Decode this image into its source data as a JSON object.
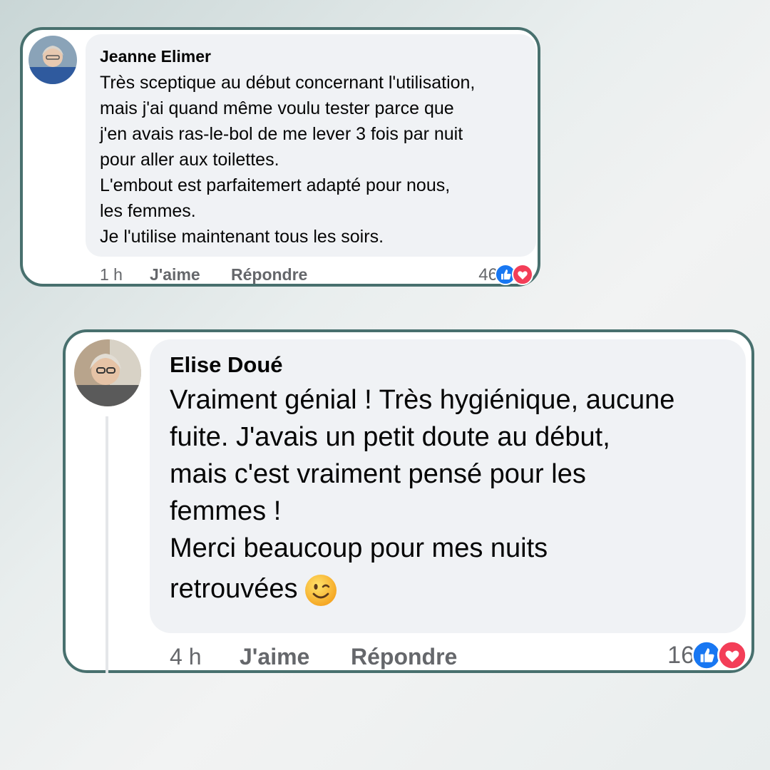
{
  "comments": [
    {
      "author": "Jeanne Elimer",
      "lines": [
        "Très sceptique au début concernant l'utilisation,",
        "mais j'ai quand même voulu tester parce que",
        "j'en avais ras-le-bol de me lever 3 fois par nuit",
        "pour aller aux toilettes.",
        "L'embout est parfaitemert adapté pour nous,",
        "les femmes.",
        "Je l'utilise maintenant tous les soirs."
      ],
      "time": "1 h",
      "like_label": "J'aime",
      "reply_label": "Répondre",
      "reaction_count": "46",
      "reaction_icons": [
        "like-icon",
        "love-icon"
      ]
    },
    {
      "author": "Elise Doué",
      "lines": [
        "Vraiment génial ! Très hygiénique, aucune",
        "fuite. J'avais un petit doute au début,",
        "mais c'est vraiment pensé pour les",
        "femmes !",
        "Merci beaucoup pour mes nuits",
        "retrouvées"
      ],
      "trailing_emoji": "winking-face-emoji",
      "time": "4 h",
      "like_label": "J'aime",
      "reply_label": "Répondre",
      "reaction_count": "16",
      "reaction_icons": [
        "like-icon",
        "love-icon"
      ]
    }
  ],
  "colors": {
    "card_border": "#48706e",
    "bubble": "#f0f2f5",
    "meta_text": "#65676b",
    "like_blue": "#1877f2",
    "love_red": "#f33e58"
  }
}
